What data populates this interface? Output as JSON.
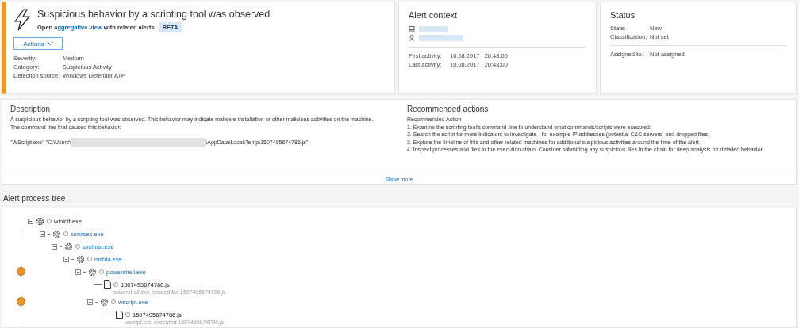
{
  "alert": {
    "title": "Suspicious behavior by a scripting tool was observed",
    "aggregate": {
      "before": "Open",
      "link": "aggregative view",
      "after": "with related alerts.",
      "badge": "BETA"
    },
    "actions_button": "Actions",
    "fields": [
      {
        "label": "Severity:",
        "value": "Medium"
      },
      {
        "label": "Category:",
        "value": "Suspicious Activity"
      },
      {
        "label": "Detection source:",
        "value": "Windows Defender ATP"
      }
    ]
  },
  "alert_context": {
    "title": "Alert context",
    "entities": [
      {
        "kind": "machine"
      },
      {
        "kind": "user"
      }
    ],
    "times": [
      {
        "label": "First activity:",
        "value": "10.08.2017 | 20:48:00"
      },
      {
        "label": "Last activity:",
        "value": "10.08.2017 | 20:48:00"
      }
    ]
  },
  "status": {
    "title": "Status",
    "fields": [
      {
        "label": "State:",
        "value": "New"
      },
      {
        "label": "Classification:",
        "value": "Not set"
      }
    ],
    "assigned": {
      "label": "Assigned to:",
      "value": "Not assigned"
    }
  },
  "description": {
    "title": "Description",
    "text": "A suspicious behavior by a scripting tool was observed. This behavior may indicate malware installation or other malicious activities on the machine.",
    "text2": "The command-line that caused this behavior:",
    "command_before": "\"WScript.exe\" \"C:\\Users\\",
    "command_after": "\\AppData\\Local\\Temp\\1507495674786.js\""
  },
  "recommended": {
    "title": "Recommended actions",
    "subtitle": "Recommended Action",
    "steps": [
      "1. Examine the scripting tool's command-line to understand what commands/scripts were executed.",
      "2. Search the script for more indicators to investigate - for example IP addresses (potential C&C servers) and dropped files.",
      "3. Explore the timeline of this and other related machines for additional suspicious activities around the time of the alert.",
      "4. Inspect processes and files in the execution chain. Consider submitting any suspicious files in the chain for deep analysis for detailed behavior"
    ]
  },
  "show_more": "Show more",
  "process_tree": {
    "title": "Alert process tree",
    "nodes": [
      {
        "kind": "process",
        "name": "wininit.exe",
        "link": false,
        "alert": false,
        "expanded": true,
        "children": [
          {
            "kind": "process",
            "name": "services.exe",
            "link": true,
            "alert": false,
            "expanded": true,
            "children": [
              {
                "kind": "process",
                "name": "svchost.exe",
                "link": true,
                "alert": false,
                "expanded": true,
                "children": [
                  {
                    "kind": "process",
                    "name": "mshta.exe",
                    "link": true,
                    "alert": false,
                    "expanded": true,
                    "children": [
                      {
                        "kind": "process",
                        "name": "powershell.exe",
                        "link": true,
                        "alert": true,
                        "expanded": true,
                        "children": [
                          {
                            "kind": "file",
                            "name": "1507495674786.js",
                            "note": "powershell.exe created file 1507495674786.js",
                            "alert": false
                          },
                          {
                            "kind": "process",
                            "name": "wscript.exe",
                            "link": true,
                            "alert": true,
                            "expanded": true,
                            "children": [
                              {
                                "kind": "file",
                                "name": "1507495674786.js",
                                "note": "wscript.exe executed 1507495674786.js",
                                "alert": false
                              }
                            ]
                          }
                        ]
                      }
                    ]
                  }
                ]
              }
            ]
          }
        ]
      }
    ]
  }
}
